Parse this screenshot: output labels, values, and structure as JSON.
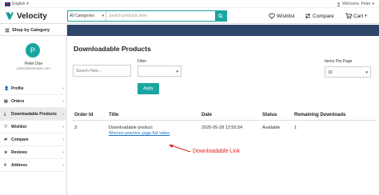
{
  "topbar": {
    "language": "English",
    "welcome": "Welcome, Peter"
  },
  "header": {
    "brand": "Velocity",
    "search_category": "All Categories",
    "search_placeholder": "Search products here",
    "wishlist": "Wishlist",
    "compare": "Compare",
    "cart": "Cart"
  },
  "subnav": {
    "shop_by_category": "Shop by Category"
  },
  "profile": {
    "initial": "P",
    "name": "Peter Doe",
    "email": "peter@example.com"
  },
  "sidebar": {
    "items": [
      {
        "label": "Profile",
        "icon": "user-icon"
      },
      {
        "label": "Orders",
        "icon": "orders-icon"
      },
      {
        "label": "Downloadable Products",
        "icon": "download-icon",
        "active": true
      },
      {
        "label": "Wishlist",
        "icon": "heart-icon"
      },
      {
        "label": "Compare",
        "icon": "compare-icon"
      },
      {
        "label": "Reviews",
        "icon": "star-icon"
      },
      {
        "label": "Address",
        "icon": "location-icon"
      }
    ]
  },
  "main": {
    "title": "Downloadable Products",
    "search_placeholder": "Search Here...",
    "filter_label": "Filter",
    "items_per_page_label": "Items Per Page",
    "items_per_page_value": "10",
    "apply": "Apply",
    "table": {
      "headers": [
        "Order Id",
        "Title",
        "Date",
        "Status",
        "Remaining Downloads"
      ],
      "rows": [
        {
          "order_id": "3",
          "title": "Downloadable product",
          "link": "Women practice yoga full video",
          "date": "2020-05-28 12:55:54",
          "status": "Available",
          "remaining": "1"
        }
      ]
    }
  },
  "annotation": {
    "text": "Downloadable Link",
    "color": "#e02020"
  },
  "colors": {
    "accent": "#1aa5a0",
    "navbar": "#2d4569",
    "link": "#1a73c8"
  }
}
